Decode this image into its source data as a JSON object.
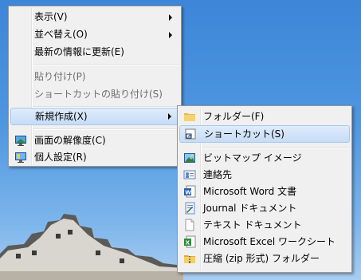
{
  "context_menu": {
    "items": [
      {
        "label": "表示(V)",
        "submenu": true,
        "disabled": false
      },
      {
        "label": "並べ替え(O)",
        "submenu": true,
        "disabled": false
      },
      {
        "label": "最新の情報に更新(E)",
        "submenu": false,
        "disabled": false
      },
      {
        "label": "貼り付け(P)",
        "submenu": false,
        "disabled": true
      },
      {
        "label": "ショートカットの貼り付け(S)",
        "submenu": false,
        "disabled": true
      },
      {
        "label": "新規作成(X)",
        "submenu": true,
        "disabled": false,
        "highlighted": true
      },
      {
        "label": "画面の解像度(C)",
        "icon": "display-resolution-icon"
      },
      {
        "label": "個人設定(R)",
        "icon": "personalize-icon"
      }
    ]
  },
  "new_submenu": {
    "items": [
      {
        "label": "フォルダー(F)",
        "icon": "folder-icon"
      },
      {
        "label": "ショートカット(S)",
        "icon": "shortcut-icon",
        "highlighted": true
      },
      {
        "label": "ビットマップ イメージ",
        "icon": "bitmap-image-icon"
      },
      {
        "label": "連絡先",
        "icon": "contact-icon"
      },
      {
        "label": "Microsoft Word 文書",
        "icon": "word-document-icon"
      },
      {
        "label": "Journal ドキュメント",
        "icon": "journal-document-icon"
      },
      {
        "label": "テキスト ドキュメント",
        "icon": "text-document-icon"
      },
      {
        "label": "Microsoft Excel ワークシート",
        "icon": "excel-worksheet-icon"
      },
      {
        "label": "圧縮 (zip 形式) フォルダー",
        "icon": "zip-folder-icon"
      }
    ]
  },
  "colors": {
    "menu_bg": "#f0f0f0",
    "highlight": "#c6dcf6",
    "desktop": "#4f97e0"
  }
}
